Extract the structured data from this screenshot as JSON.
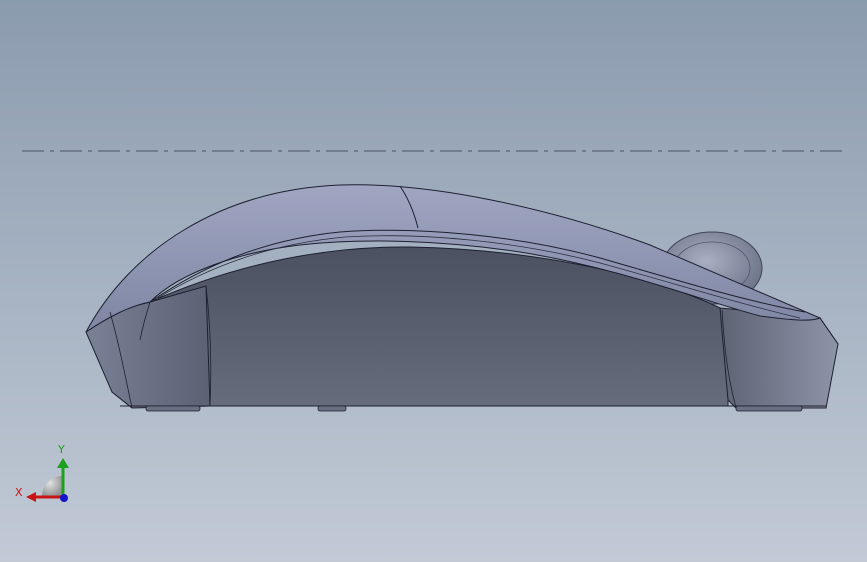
{
  "viewport": {
    "background_top": "#8b9bae",
    "background_bottom": "#c2cad6"
  },
  "model": {
    "body_color": "#5e6475",
    "top_shell_color": "#9097b4",
    "edge_color": "#1d2030"
  },
  "triad": {
    "x_label": "X",
    "y_label": "Y",
    "x_color": "#c81414",
    "y_color": "#1ea01e",
    "z_color": "#1414c8",
    "icon": "view-orientation-triad-icon"
  }
}
